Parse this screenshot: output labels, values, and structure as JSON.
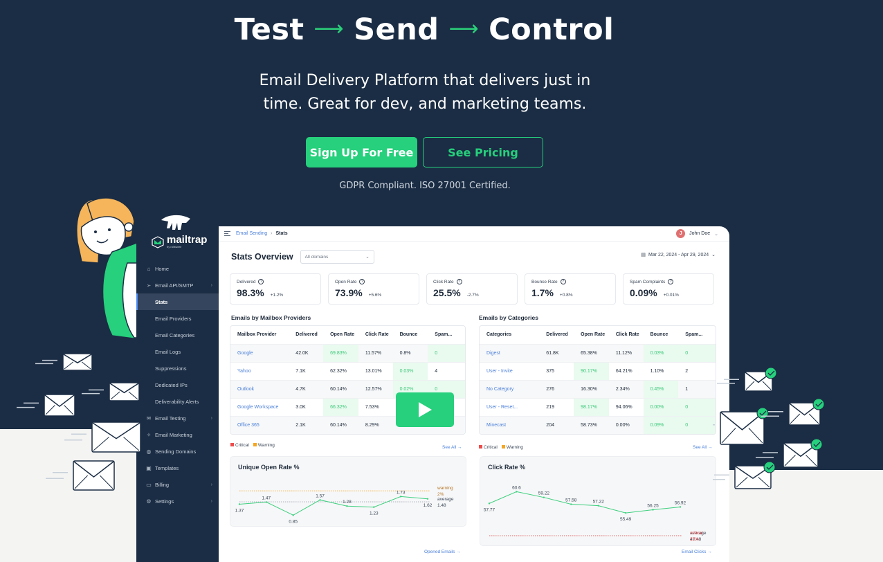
{
  "hero": {
    "title_words": [
      "Test",
      "Send",
      "Control"
    ],
    "arrow": "⟶",
    "subtitle_line1": "Email Delivery Platform that delivers just in",
    "subtitle_line2": "time. Great for dev, and marketing teams.",
    "primary_cta": "Sign Up For Free",
    "secondary_cta": "See Pricing",
    "compliance": "GDPR Compliant. ISO 27001 Certified."
  },
  "colors": {
    "brand_green": "#26d07c",
    "navy": "#1b2d44",
    "link_blue": "#4a7fd9",
    "critical": "#ef4b4b",
    "warning": "#f5a623"
  },
  "sidebar": {
    "logo": "mailtrap",
    "logo_by": "by railsware",
    "items": [
      {
        "label": "Home",
        "icon": "home-icon",
        "chevron": false,
        "sub": false,
        "active": false
      },
      {
        "label": "Email API/SMTP",
        "icon": "send-icon",
        "chevron": true,
        "sub": false,
        "active": false
      },
      {
        "label": "Stats",
        "icon": "",
        "chevron": false,
        "sub": true,
        "active": true
      },
      {
        "label": "Email Providers",
        "icon": "",
        "chevron": false,
        "sub": true,
        "active": false
      },
      {
        "label": "Email Categories",
        "icon": "",
        "chevron": false,
        "sub": true,
        "active": false
      },
      {
        "label": "Email Logs",
        "icon": "",
        "chevron": false,
        "sub": true,
        "active": false
      },
      {
        "label": "Suppressions",
        "icon": "",
        "chevron": false,
        "sub": true,
        "active": false
      },
      {
        "label": "Dedicated IPs",
        "icon": "",
        "chevron": false,
        "sub": true,
        "active": false
      },
      {
        "label": "Deliverability Alerts",
        "icon": "",
        "chevron": false,
        "sub": true,
        "active": false
      },
      {
        "label": "Email Testing",
        "icon": "inbox-test-icon",
        "chevron": true,
        "sub": false,
        "active": false
      },
      {
        "label": "Email Marketing",
        "icon": "sparkle-icon",
        "chevron": false,
        "sub": false,
        "active": false
      },
      {
        "label": "Sending Domains",
        "icon": "globe-icon",
        "chevron": false,
        "sub": false,
        "active": false
      },
      {
        "label": "Templates",
        "icon": "template-icon",
        "chevron": false,
        "sub": false,
        "active": false
      },
      {
        "label": "Billing",
        "icon": "card-icon",
        "chevron": true,
        "sub": false,
        "active": false
      },
      {
        "label": "Settings",
        "icon": "gear-icon",
        "chevron": true,
        "sub": false,
        "active": false
      }
    ]
  },
  "topbar": {
    "breadcrumb_parent": "Email Sending",
    "breadcrumb_sep": "›",
    "breadcrumb_current": "Stats",
    "user_initial": "J",
    "user_name": "John Doe"
  },
  "overview": {
    "title": "Stats Overview",
    "domain_select": "All domains",
    "date_range": "Mar 22, 2024 - Apr 29, 2024",
    "kpis": [
      {
        "label": "Delivered",
        "value": "98.3%",
        "delta": "+1.2%"
      },
      {
        "label": "Open Rate",
        "value": "73.9%",
        "delta": "+5.6%"
      },
      {
        "label": "Click Rate",
        "value": "25.5%",
        "delta": "-2.7%"
      },
      {
        "label": "Bounce Rate",
        "value": "1.7%",
        "delta": "+0.8%"
      },
      {
        "label": "Spam Complaints",
        "value": "0.09%",
        "delta": "+0.01%"
      }
    ]
  },
  "providers": {
    "title": "Emails by Mailbox Providers",
    "columns": [
      "Mailbox Provider",
      "Delivered",
      "Open Rate",
      "Click Rate",
      "Bounce",
      "Spam..."
    ],
    "rows": [
      {
        "cells": [
          "Google",
          "42.0K",
          "69.83%",
          "11.57%",
          "0.8%",
          "0"
        ],
        "good": [
          2,
          5
        ]
      },
      {
        "cells": [
          "Yahoo",
          "7.1K",
          "62.32%",
          "13.01%",
          "0.03%",
          "4"
        ],
        "good": [
          4
        ]
      },
      {
        "cells": [
          "Outlook",
          "4.7K",
          "60.14%",
          "12.57%",
          "0.02%",
          "0"
        ],
        "good": [
          4,
          5
        ]
      },
      {
        "cells": [
          "Google Workspace",
          "3.0K",
          "66.32%",
          "7.53%",
          "",
          ""
        ],
        "good": [
          2
        ]
      },
      {
        "cells": [
          "Office 365",
          "2.1K",
          "60.14%",
          "8.29%",
          "",
          ""
        ],
        "good": []
      }
    ],
    "legend_critical": "Critical",
    "legend_warning": "Warning",
    "see_all": "See All →"
  },
  "categories": {
    "title": "Emails by Categories",
    "columns": [
      "Categories",
      "Delivered",
      "Open Rate",
      "Click Rate",
      "Bounce",
      "Spam..."
    ],
    "rows": [
      {
        "cells": [
          "Digest",
          "61.8K",
          "65.38%",
          "11.12%",
          "0.03%",
          "0"
        ],
        "good": [
          4,
          5
        ]
      },
      {
        "cells": [
          "User - Invite",
          "375",
          "90.17%",
          "64.21%",
          "1.10%",
          "2"
        ],
        "good": [
          2
        ]
      },
      {
        "cells": [
          "No Category",
          "276",
          "16.30%",
          "2.34%",
          "0.45%",
          "1"
        ],
        "good": [
          4
        ]
      },
      {
        "cells": [
          "User - Reset...",
          "219",
          "98.17%",
          "94.06%",
          "0.00%",
          "0"
        ],
        "good": [
          2,
          4,
          5
        ]
      },
      {
        "cells": [
          "Minecast",
          "204",
          "58.73%",
          "0.00%",
          "0.09%",
          "0"
        ],
        "good": [
          4,
          5
        ]
      }
    ],
    "legend_critical": "Critical",
    "legend_warning": "Warning",
    "see_all": "See All →"
  },
  "chart_data": [
    {
      "type": "line",
      "title": "Unique Open Rate %",
      "values": [
        1.37,
        1.47,
        0.85,
        1.57,
        1.28,
        1.23,
        1.73,
        1.62
      ],
      "labels": [
        "1.37",
        "1.47",
        "0.85",
        "1.57",
        "1.28",
        "1.23",
        "1.73",
        "1.62"
      ],
      "reference_lines": [
        {
          "name": "warning",
          "value": 2,
          "label": "warning",
          "sub": "2%",
          "color": "#f5a623"
        },
        {
          "name": "average",
          "value": 1.48,
          "label": "average",
          "sub": "1.48",
          "color": "#9aa3ae"
        }
      ],
      "ylim": [
        0.6,
        2.3
      ],
      "footer_link": "Opened Emails →"
    },
    {
      "type": "line",
      "title": "Click Rate %",
      "values": [
        57.77,
        60.6,
        59.22,
        57.58,
        57.22,
        55.49,
        56.25,
        56.92
      ],
      "labels": [
        "57.77",
        "60.6",
        "59.22",
        "57.58",
        "57.22",
        "55.49",
        "56.25",
        "56.92"
      ],
      "reference_lines": [
        {
          "name": "average",
          "value": 47.48,
          "label": "average",
          "sub": "47.48",
          "color": "#9aa3ae"
        },
        {
          "name": "critical",
          "value": 25,
          "label": "critical",
          "sub": "25%",
          "color": "#ef4b4b"
        }
      ],
      "ylim": [
        52,
        62
      ],
      "footer_link": "Email Clicks →"
    }
  ],
  "video": {
    "play_label": "Play video"
  }
}
